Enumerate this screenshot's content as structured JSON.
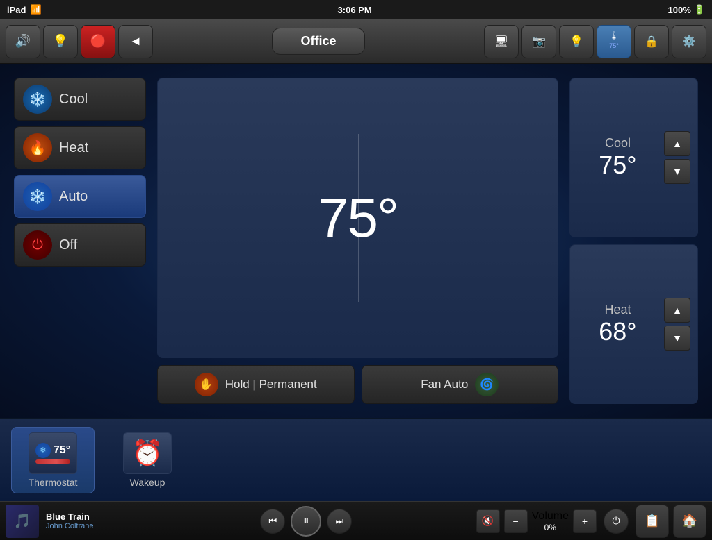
{
  "status_bar": {
    "device": "iPad",
    "wifi": "wifi",
    "time": "3:06 PM",
    "battery": "100%"
  },
  "nav": {
    "title": "Office",
    "buttons": {
      "sound": "🔊",
      "light": "💡",
      "record": "◄",
      "back": "◄"
    },
    "right_buttons": [
      "monitor",
      "camera",
      "light",
      "thermostat",
      "lock",
      "settings"
    ]
  },
  "thermostat": {
    "current_temp": "75°",
    "mode_buttons": [
      {
        "id": "cool",
        "label": "Cool",
        "active": false
      },
      {
        "id": "heat",
        "label": "Heat",
        "active": false
      },
      {
        "id": "auto",
        "label": "Auto",
        "active": true
      },
      {
        "id": "off",
        "label": "Off",
        "active": false
      }
    ],
    "hold_button": "Hold | Permanent",
    "fan_button": "Fan Auto",
    "cool_setpoint": {
      "label": "Cool",
      "value": "75°"
    },
    "heat_setpoint": {
      "label": "Heat",
      "value": "68°"
    }
  },
  "favorites": [
    {
      "id": "thermostat",
      "label": "Thermostat",
      "active": true,
      "temp": "75°"
    },
    {
      "id": "wakeup",
      "label": "Wakeup",
      "active": false
    }
  ],
  "media": {
    "track_name": "Blue Train",
    "artist": "John Coltrane",
    "volume_label": "Volume",
    "volume_value": "0%",
    "prev": "⏮",
    "pause": "⏸",
    "next": "⏭"
  }
}
